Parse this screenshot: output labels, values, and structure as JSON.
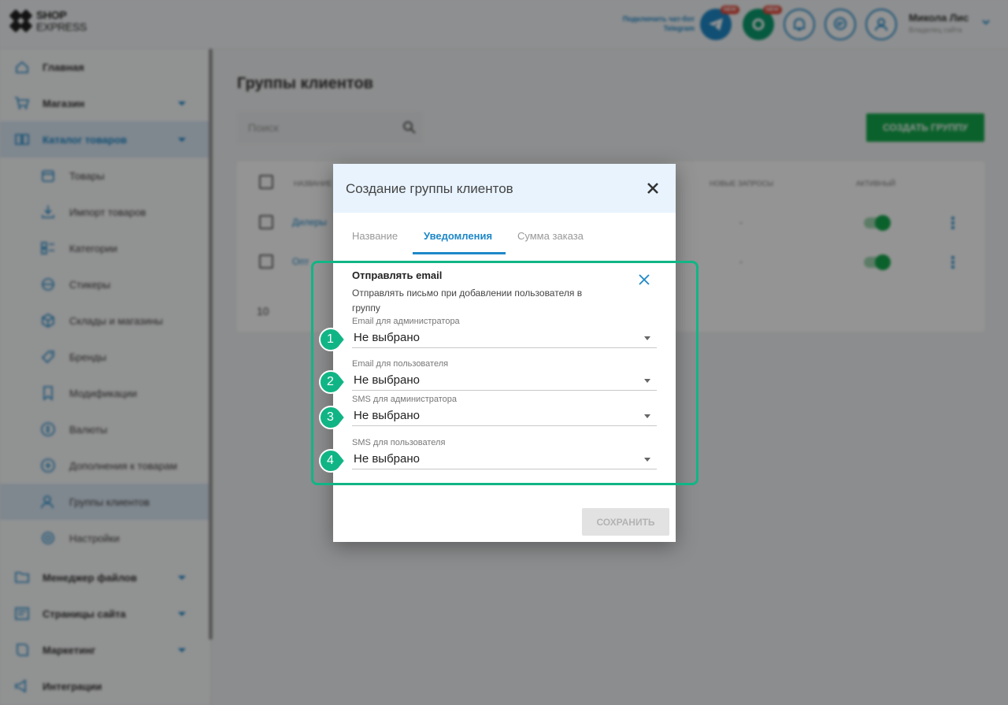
{
  "app": {
    "logo_top": "SHOP",
    "logo_bottom": "EXPRESS",
    "telegram_link_line1": "Подключить чат-бот",
    "telegram_link_line2": "Telegram",
    "badge_new": "NEW",
    "user_name": "Микола Лис",
    "user_role": "Владелец сайта"
  },
  "sidebar": {
    "main": [
      {
        "label": "Главная",
        "icon": "home-icon"
      },
      {
        "label": "Магазин",
        "icon": "cart-icon"
      },
      {
        "label": "Каталог товаров",
        "icon": "book-icon"
      }
    ],
    "catalog_items": [
      {
        "label": "Товары",
        "icon": "box-icon"
      },
      {
        "label": "Импорт товаров",
        "icon": "import-icon"
      },
      {
        "label": "Категории",
        "icon": "categories-icon"
      },
      {
        "label": "Стикеры",
        "icon": "sticker-icon"
      },
      {
        "label": "Склады и магазины",
        "icon": "warehouse-icon"
      },
      {
        "label": "Бренды",
        "icon": "tag-icon"
      },
      {
        "label": "Модификации",
        "icon": "bookmark-icon"
      },
      {
        "label": "Валюты",
        "icon": "currency-icon"
      },
      {
        "label": "Дополнения к товарам",
        "icon": "plus-circle-icon"
      },
      {
        "label": "Группы клиентов",
        "icon": "users-icon"
      },
      {
        "label": "Настройки",
        "icon": "settings-icon"
      }
    ],
    "bottom": [
      {
        "label": "Менеджер файлов",
        "icon": "folder-icon"
      },
      {
        "label": "Страницы сайта",
        "icon": "pages-icon"
      },
      {
        "label": "Маркетинг",
        "icon": "marketing-icon"
      },
      {
        "label": "Интеграции",
        "icon": "integrations-icon"
      }
    ]
  },
  "page": {
    "title": "Группы клиентов",
    "search_placeholder": "Поиск",
    "create_button": "СОЗДАТЬ ГРУППУ",
    "columns": {
      "name": "НАЗВАНИЕ",
      "new_requests": "НОВЫЕ ЗАПРОСЫ",
      "active": "АКТИВНЫЙ"
    },
    "rows": [
      {
        "name": "Дилеры",
        "requests": "-"
      },
      {
        "name": "Опт",
        "requests": "-"
      }
    ],
    "per_page": "10"
  },
  "dialog": {
    "title": "Создание группы клиентов",
    "tabs": [
      "Название",
      "Уведомления",
      "Сумма заказа"
    ],
    "section_title": "Отправлять email",
    "section_desc": "Отправлять письмо при добавлении пользователя в группу",
    "fields": [
      {
        "marker": "1",
        "label": "Email для администратора",
        "value": "Не выбрано"
      },
      {
        "marker": "2",
        "label": "Email для пользователя",
        "value": "Не выбрано"
      },
      {
        "marker": "3",
        "label": "SMS для администратора",
        "value": "Не выбрано"
      },
      {
        "marker": "4",
        "label": "SMS для пользователя",
        "value": "Не выбрано"
      }
    ],
    "save_button": "СОХРАНИТЬ"
  },
  "colors": {
    "accent": "#1e88c8",
    "highlight": "#11b585",
    "create": "#14a84b"
  }
}
